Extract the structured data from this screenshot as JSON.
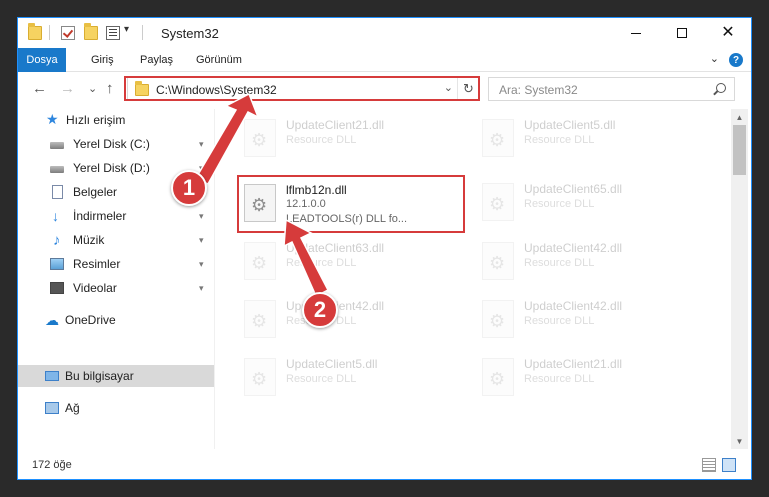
{
  "window": {
    "title": "System32",
    "title_dropdown": "▾",
    "minimize": "—",
    "maximize": "□",
    "close": "✕"
  },
  "ribbon": {
    "file": "Dosya",
    "tabs": [
      "Giriş",
      "Paylaş",
      "Görünüm"
    ],
    "expand": "⌄",
    "help": "?"
  },
  "nav": {
    "back": "←",
    "forward": "→",
    "recent": "⌄",
    "up": "↑"
  },
  "address": {
    "path": "C:\\Windows\\System32",
    "dropdown": "⌄",
    "refresh": "↻"
  },
  "search": {
    "placeholder": "Ara: System32"
  },
  "sidebar": {
    "items": [
      {
        "label": "Hızlı erişim",
        "icon": "star-icon",
        "pinned": false
      },
      {
        "label": "Yerel Disk (C:)",
        "icon": "drive-icon",
        "pinned": true
      },
      {
        "label": "Yerel Disk (D:)",
        "icon": "drive-icon",
        "pinned": true
      },
      {
        "label": "Belgeler",
        "icon": "documents-icon",
        "pinned": true
      },
      {
        "label": "İndirmeler",
        "icon": "downloads-icon",
        "pinned": true
      },
      {
        "label": "Müzik",
        "icon": "music-icon",
        "pinned": true
      },
      {
        "label": "Resimler",
        "icon": "pictures-icon",
        "pinned": true
      },
      {
        "label": "Videolar",
        "icon": "videos-icon",
        "pinned": true
      },
      {
        "label": "OneDrive",
        "icon": "onedrive-icon",
        "pinned": false
      },
      {
        "label": "Bu bilgisayar",
        "icon": "this-pc-icon",
        "pinned": false,
        "selected": true
      },
      {
        "label": "Ağ",
        "icon": "network-icon",
        "pinned": false
      }
    ],
    "pin_glyph": "📌"
  },
  "files": {
    "focus": {
      "name": "lflmb12n.dll",
      "version": "12.1.0.0",
      "description": "LEADTOOLS(r) DLL fo..."
    },
    "background": [
      {
        "name": "UpdateClient21.dll",
        "type": "Resource DLL"
      },
      {
        "name": "UpdateClient5.dll",
        "type": "Resource DLL"
      },
      {
        "name": "UpdateClient65.dll",
        "type": "Resource DLL"
      },
      {
        "name": "UpdateClient63.dll",
        "type": "Resource DLL"
      },
      {
        "name": "UpdateClient42.dll",
        "type": "Resource DLL"
      },
      {
        "name": "UpdateClient42.dll",
        "type": "Resource DLL"
      },
      {
        "name": "UpdateClient42.dll",
        "type": "Resource DLL"
      },
      {
        "name": "UpdateClient5.dll",
        "type": "Resource DLL"
      },
      {
        "name": "UpdateClient21.dll",
        "type": "Resource DLL"
      }
    ]
  },
  "status": {
    "count": "172 öğe"
  },
  "annotations": {
    "marker1": "1",
    "marker2": "2",
    "color": "#d63b3b"
  },
  "colors": {
    "accent": "#1979ca",
    "highlight": "#d63b3b",
    "selected_nav": "#d9d9d9"
  }
}
